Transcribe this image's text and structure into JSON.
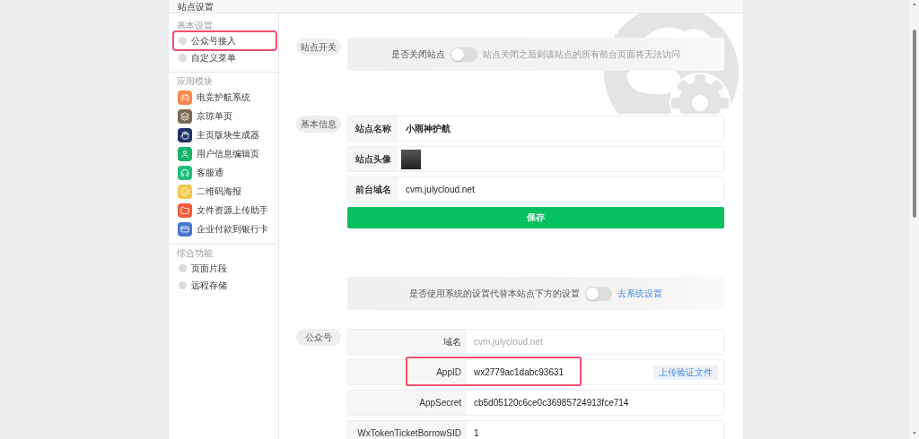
{
  "page_title": "站点设置",
  "sidebar": {
    "groups": [
      {
        "title": "基本设置",
        "items": [
          {
            "label": "公众号接入",
            "kind": "dot",
            "highlighted": true
          },
          {
            "label": "自定义菜单",
            "kind": "dot",
            "highlighted": false
          }
        ]
      },
      {
        "title": "应用模块",
        "items": [
          {
            "label": "电竞护航系统",
            "kind": "app",
            "color": "#f5874f",
            "highlighted": false
          },
          {
            "label": "京琼单页",
            "kind": "app",
            "color": "#7a6a55",
            "highlighted": false
          },
          {
            "label": "主页版块生成器",
            "kind": "app",
            "color": "#1f3464",
            "highlighted": false
          },
          {
            "label": "用户信息编辑页",
            "kind": "app",
            "color": "#16b26a",
            "highlighted": false
          },
          {
            "label": "客服通",
            "kind": "app",
            "color": "#1fbf7a",
            "highlighted": false
          },
          {
            "label": "二维码海报",
            "kind": "app",
            "color": "#f2c94c",
            "highlighted": false
          },
          {
            "label": "文件资源上传助手",
            "kind": "app",
            "color": "#f25c3c",
            "highlighted": false
          },
          {
            "label": "企业付款到银行卡",
            "kind": "app",
            "color": "#4a78d0",
            "highlighted": false
          }
        ]
      },
      {
        "title": "综合功能",
        "items": [
          {
            "label": "页面片段",
            "kind": "dot",
            "highlighted": false
          },
          {
            "label": "远程存储",
            "kind": "dot",
            "highlighted": false
          }
        ]
      }
    ]
  },
  "sections": [
    {
      "kind": "switch",
      "tag": "站点开关",
      "label": "是否关闭站点",
      "on": false,
      "hint": "站点关闭之后则该站点的所有前台页面将无法访问"
    },
    {
      "kind": "form",
      "tag": "基本信息",
      "rows": [
        {
          "kind": "text",
          "label": "站点名称",
          "value": "小雨神护航",
          "bold": true,
          "highlighted": false
        },
        {
          "kind": "image",
          "label": "站点头像",
          "highlighted": false
        },
        {
          "kind": "text",
          "label": "前台域名",
          "value": "cvm.julycloud.net",
          "bold": false,
          "highlighted": false
        }
      ],
      "button": "保存"
    },
    {
      "kind": "switch",
      "label": "是否使用系统的设置代替本站点下方的设置",
      "on": false,
      "link": "去系统设置"
    },
    {
      "kind": "form",
      "tag": "公众号",
      "rows": [
        {
          "kind": "text",
          "label": "域名",
          "placeholder": "cvm.julycloud.net",
          "highlighted": false
        },
        {
          "kind": "text",
          "label": "AppID",
          "value": "wx2779ac1dabc93631",
          "highlighted": true,
          "action": "上传验证文件"
        },
        {
          "kind": "text",
          "label": "AppSecret",
          "value": "cb5d05120c6ce0c36985724913fce714",
          "highlighted": false
        },
        {
          "kind": "text",
          "label": "WxTokenTicketBorrowSID",
          "value": "1",
          "highlighted": false
        }
      ]
    }
  ]
}
